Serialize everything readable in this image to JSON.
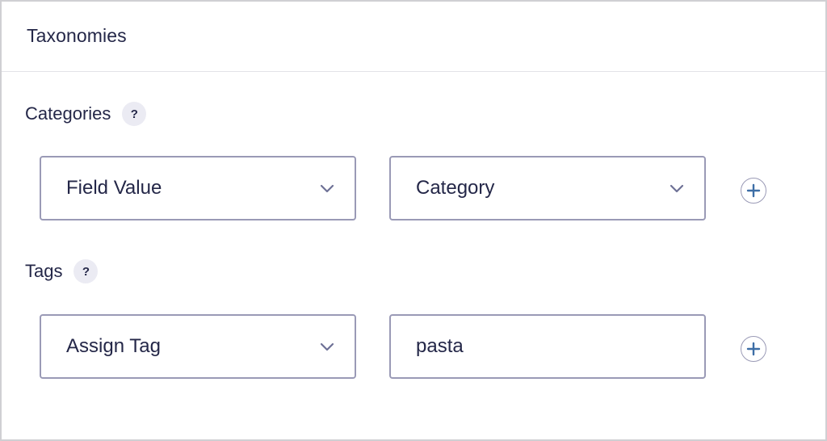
{
  "panel": {
    "title": "Taxonomies"
  },
  "categories": {
    "label": "Categories",
    "help": "?",
    "source_select": {
      "value": "Field Value",
      "icon": "chevron-down-icon"
    },
    "target_select": {
      "value": "Category",
      "icon": "chevron-down-icon"
    },
    "add_icon": "plus-circle-icon"
  },
  "tags": {
    "label": "Tags",
    "help": "?",
    "source_select": {
      "value": "Assign Tag",
      "icon": "chevron-down-icon"
    },
    "value_input": {
      "value": "pasta"
    },
    "add_icon": "plus-circle-icon"
  },
  "colors": {
    "text": "#242748",
    "border": "#9a9ab6",
    "help_bg": "#ebebf3",
    "accent": "#3d6ea6"
  }
}
